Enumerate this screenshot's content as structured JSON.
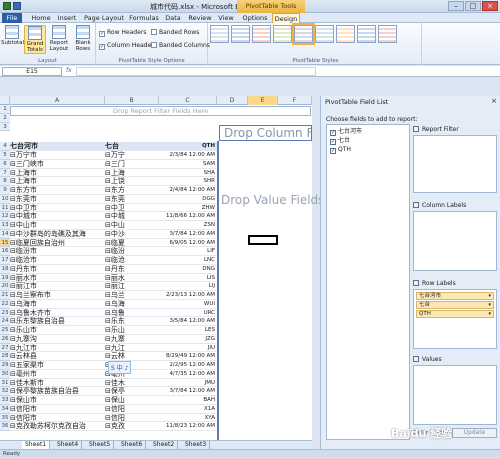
{
  "window": {
    "title": "城市代码.xlsx - Microsoft Excel",
    "pivot_tools": "PivotTable Tools"
  },
  "tabs": [
    "File",
    "Home",
    "Insert",
    "Page Layout",
    "Formulas",
    "Data",
    "Review",
    "View",
    "Options",
    "Design"
  ],
  "ribbon": {
    "subtotals": "Subtotals",
    "grand_totals": "Grand Totals",
    "report_layout": "Report Layout",
    "blank_rows": "Blank Rows",
    "layout_group": "Layout",
    "row_headers": "Row Headers",
    "column_headers": "Column Headers",
    "banded_rows": "Banded Rows",
    "banded_columns": "Banded Columns",
    "style_options_group": "PivotTable Style Options",
    "styles_group": "PivotTable Styles"
  },
  "formula_bar": {
    "name_box": "E15",
    "fx": "fx",
    "value": ""
  },
  "grid": {
    "columns": [
      "A",
      "B",
      "C",
      "D",
      "E",
      "F"
    ],
    "filter_drop": "Drop Report Filter Fields Here",
    "drop_column": "Drop Column Fields Here",
    "drop_value": "Drop Value Fields Here",
    "header": {
      "a": "七台河市",
      "b": "七台",
      "c": "QTH"
    },
    "rows": [
      {
        "n": "5",
        "a": "⊟万宁市",
        "b": "⊟万宁",
        "c": "2/3/84 12:00 AM"
      },
      {
        "n": "6",
        "a": "⊟三门峡市",
        "b": "⊟三门",
        "c": "SAM"
      },
      {
        "n": "7",
        "a": "⊟上海市",
        "b": "⊟上海",
        "c": "SHA"
      },
      {
        "n": "8",
        "a": "⊟上海市",
        "b": "⊟上饶",
        "c": "SHR"
      },
      {
        "n": "9",
        "a": "⊟东方市",
        "b": "⊟东方",
        "c": "2/4/84 12:00 AM"
      },
      {
        "n": "10",
        "a": "⊟东莞市",
        "b": "⊟东莞",
        "c": "DGG"
      },
      {
        "n": "11",
        "a": "⊟中卫市",
        "b": "⊟中卫",
        "c": "ZHW"
      },
      {
        "n": "12",
        "a": "⊟中城市",
        "b": "⊟中城",
        "c": "11/8/66 12:00 AM"
      },
      {
        "n": "13",
        "a": "⊟中山市",
        "b": "⊟中山",
        "c": "ZSN"
      },
      {
        "n": "14",
        "a": "⊟中沙群岛的岛礁及其海",
        "b": "⊟中沙",
        "c": "3/7/84 12:00 AM"
      },
      {
        "n": "15",
        "a": "⊟临夏回族自治州",
        "b": "⊟临夏",
        "c": "6/9/05 12:00 AM"
      },
      {
        "n": "16",
        "a": "⊟临汾市",
        "b": "⊟临汾",
        "c": "LIF"
      },
      {
        "n": "17",
        "a": "⊟临沧市",
        "b": "⊟临沧",
        "c": "LNC"
      },
      {
        "n": "18",
        "a": "⊟丹东市",
        "b": "⊟丹东",
        "c": "DNG"
      },
      {
        "n": "19",
        "a": "⊟丽水市",
        "b": "⊟丽水",
        "c": "LIS"
      },
      {
        "n": "20",
        "a": "⊟丽江市",
        "b": "⊟丽江",
        "c": "LIJ"
      },
      {
        "n": "21",
        "a": "⊟乌兰察布市",
        "b": "⊟乌兰",
        "c": "2/23/13 12:00 AM"
      },
      {
        "n": "22",
        "a": "⊟乌海市",
        "b": "⊟乌海",
        "c": "WUI"
      },
      {
        "n": "23",
        "a": "⊟乌鲁木齐市",
        "b": "⊟乌鲁",
        "c": "URC"
      },
      {
        "n": "24",
        "a": "⊟乐东黎族自治县",
        "b": "⊟乐东",
        "c": "3/5/84 12:00 AM"
      },
      {
        "n": "25",
        "a": "⊟乐山市",
        "b": "⊟乐山",
        "c": "LES"
      },
      {
        "n": "26",
        "a": "⊟九寨沟",
        "b": "⊟九寨",
        "c": "JZG"
      },
      {
        "n": "27",
        "a": "⊟九江市",
        "b": "⊟九江",
        "c": "JIU"
      },
      {
        "n": "28",
        "a": "⊟云林县",
        "b": "⊟云林",
        "c": "8/29/49 12:00 AM"
      },
      {
        "n": "29",
        "a": "⊟五家渠市",
        "b": "⊟五家",
        "c": "2/2/95 12:00 AM"
      },
      {
        "n": "30",
        "a": "⊟亳州市",
        "b": "⊟亳州",
        "c": "4/7/35 12:00 AM"
      },
      {
        "n": "31",
        "a": "⊟佳木斯市",
        "b": "⊟佳木",
        "c": "JMU"
      },
      {
        "n": "32",
        "a": "⊟保亭黎族苗族自治县",
        "b": "⊟保亭",
        "c": "3/7/84 12:00 AM"
      },
      {
        "n": "33",
        "a": "⊟保山市",
        "b": "⊟保山",
        "c": "BAH"
      },
      {
        "n": "34",
        "a": "⊟信阳市",
        "b": "⊟信阳",
        "c": "X1A"
      },
      {
        "n": "35",
        "a": "⊟信阳市",
        "b": "⊟信阳",
        "c": "XYA"
      },
      {
        "n": "36",
        "a": "⊟克孜勒苏柯尔克孜自治",
        "b": "⊟克孜",
        "c": "11/8/23 12:00 AM"
      }
    ],
    "ime_badge": "S 中 ♪"
  },
  "sheets": [
    "Sheet1",
    "Sheet4",
    "Sheet5",
    "Sheet6",
    "Sheet2",
    "Sheet3"
  ],
  "status": "Ready",
  "field_list": {
    "title": "PivotTable Field List",
    "close": "×",
    "choose_label": "Choose fields to add to report:",
    "fields": [
      "七台河市",
      "七台",
      "QTH"
    ],
    "report_filter": "Report Filter",
    "column_labels": "Column Labels",
    "row_labels": "Row Labels",
    "values": "Values",
    "row_items": [
      "七台河市",
      "七台",
      "QTH"
    ],
    "defer": "Defer Layout Update",
    "update": "Update"
  },
  "watermark": "Baidu 经验"
}
